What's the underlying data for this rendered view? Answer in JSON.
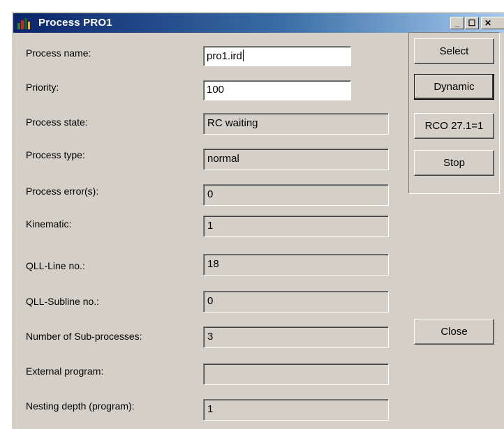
{
  "window": {
    "title": "Process PRO1",
    "title_icon": "process-app-icon"
  },
  "titlebar_buttons": {
    "minimize": "_",
    "maximize": "☐",
    "close": "✕"
  },
  "fields": [
    {
      "label": "Process name:",
      "value": "pro1.ird",
      "editable": true
    },
    {
      "label": "Priority:",
      "value": "100",
      "editable": true
    },
    {
      "label": "Process state:",
      "value": "RC waiting",
      "editable": false
    },
    {
      "label": "Process type:",
      "value": "normal",
      "editable": false
    },
    {
      "label": "Process error(s):",
      "value": "0",
      "editable": false
    },
    {
      "label": "Kinematic:",
      "value": "1",
      "editable": false
    },
    {
      "label": "QLL-Line no.:",
      "value": "18",
      "editable": false
    },
    {
      "label": "QLL-Subline no.:",
      "value": "0",
      "editable": false
    },
    {
      "label": "Number of Sub-processes:",
      "value": "3",
      "editable": false
    },
    {
      "label": "External program:",
      "value": "",
      "editable": false
    },
    {
      "label": "Nesting depth (program):",
      "value": "1",
      "editable": false
    }
  ],
  "buttons": {
    "select": "Select",
    "dynamic": "Dynamic",
    "rco": "RCO 27.1=1",
    "stop": "Stop",
    "close": "Close"
  }
}
